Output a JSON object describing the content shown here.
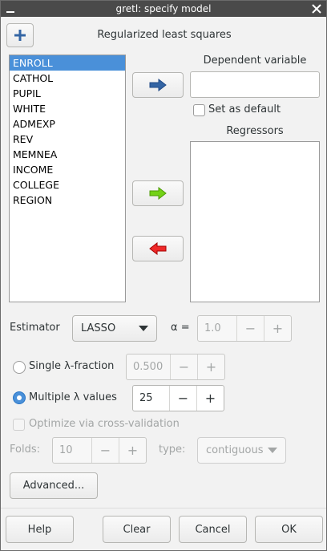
{
  "window": {
    "title": "gretl: specify model"
  },
  "header": {
    "title": "Regularized least squares"
  },
  "variables": [
    "ENROLL",
    "CATHOL",
    "PUPIL",
    "WHITE",
    "ADMEXP",
    "REV",
    "MEMNEA",
    "INCOME",
    "COLLEGE",
    "REGION"
  ],
  "selected_variable": "ENROLL",
  "dependent": {
    "label": "Dependent variable",
    "value": "",
    "set_default_label": "Set as default"
  },
  "regressors": {
    "label": "Regressors",
    "items": []
  },
  "estimator": {
    "label": "Estimator",
    "value": "LASSO",
    "alpha_label": "α =",
    "alpha_value": "1.0"
  },
  "lambda": {
    "single_label": "Single λ-fraction",
    "single_value": "0.500",
    "multiple_label": "Multiple λ values",
    "multiple_value": "25",
    "selected": "multiple"
  },
  "cv": {
    "optimize_label": "Optimize via cross-validation",
    "folds_label": "Folds:",
    "folds_value": "10",
    "type_label": "type:",
    "type_value": "contiguous"
  },
  "buttons": {
    "advanced": "Advanced...",
    "help": "Help",
    "clear": "Clear",
    "cancel": "Cancel",
    "ok": "OK"
  },
  "spin": {
    "minus": "−",
    "plus": "+"
  },
  "colors": {
    "selection": "#4a90d9",
    "arrow_blue": "#3465a4",
    "arrow_green": "#4e9a06",
    "arrow_red": "#cc0000"
  }
}
